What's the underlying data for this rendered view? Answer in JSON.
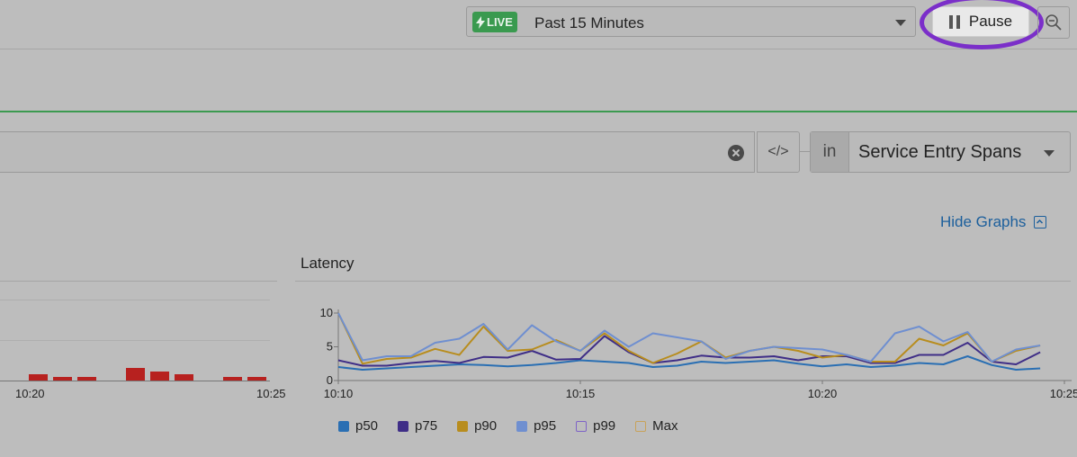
{
  "toolbar": {
    "live_badge": "LIVE",
    "time_range": "Past 15 Minutes",
    "pause_label": "Pause"
  },
  "query": {
    "code_label": "</>",
    "in_label": "in",
    "span_type": "Service Entry Spans"
  },
  "graphs": {
    "hide_label": "Hide Graphs"
  },
  "left_chart": {
    "x_ticks": [
      "10:20",
      "10:25"
    ],
    "bar_color": "#b7211f"
  },
  "chart_data": {
    "type": "line",
    "title": "Latency",
    "xlabel": "",
    "ylabel": "",
    "x_ticks": [
      "10:10",
      "10:15",
      "10:20",
      "10:25"
    ],
    "y_ticks": [
      "0",
      "5",
      "10"
    ],
    "ylim": [
      0,
      10
    ],
    "xlim_minutes": [
      0,
      15
    ],
    "legend_placement": "bottom",
    "x": [
      0,
      0.5,
      1,
      1.5,
      2,
      2.5,
      3,
      3.5,
      4,
      4.5,
      5,
      5.5,
      6,
      6.5,
      7,
      7.5,
      8,
      8.5,
      9,
      9.5,
      10,
      10.5,
      11,
      11.5,
      12,
      12.5,
      13,
      13.5,
      14,
      14.5
    ],
    "series": [
      {
        "name": "p50",
        "color": "#2a6fb3",
        "values": [
          2.0,
          1.6,
          1.8,
          2.0,
          2.2,
          2.4,
          2.3,
          2.1,
          2.3,
          2.6,
          3.0,
          2.8,
          2.6,
          2.0,
          2.2,
          2.8,
          2.6,
          2.8,
          3.0,
          2.5,
          2.1,
          2.4,
          2.0,
          2.2,
          2.6,
          2.4,
          3.6,
          2.3,
          1.6,
          1.8
        ]
      },
      {
        "name": "p75",
        "color": "#3f2e87",
        "values": [
          3.0,
          2.2,
          2.2,
          2.6,
          2.9,
          2.6,
          3.5,
          3.4,
          4.4,
          3.1,
          3.2,
          6.6,
          4.2,
          2.6,
          3.0,
          3.7,
          3.4,
          3.4,
          3.6,
          3.0,
          3.6,
          3.6,
          2.6,
          2.6,
          3.8,
          3.8,
          5.6,
          2.8,
          2.4,
          4.2
        ]
      },
      {
        "name": "p90",
        "color": "#b88d1e",
        "values": [
          10.0,
          2.5,
          3.2,
          3.4,
          4.7,
          3.8,
          8.0,
          4.4,
          4.6,
          6.0,
          4.4,
          7.0,
          4.4,
          2.6,
          4.0,
          5.8,
          3.4,
          4.4,
          5.0,
          4.4,
          3.4,
          3.8,
          2.8,
          2.8,
          6.2,
          5.2,
          7.0,
          2.8,
          4.4,
          5.2
        ]
      },
      {
        "name": "p95",
        "color": "#6f8fd0",
        "values": [
          10.0,
          3.0,
          3.6,
          3.6,
          5.6,
          6.2,
          8.4,
          4.6,
          8.2,
          5.8,
          4.4,
          7.4,
          5.0,
          7.0,
          6.4,
          5.8,
          3.2,
          4.4,
          5.0,
          4.8,
          4.6,
          3.8,
          2.8,
          7.0,
          8.0,
          5.8,
          7.2,
          2.8,
          4.6,
          5.2
        ]
      },
      {
        "name": "p99",
        "color": "#7e63c7",
        "hollow": true,
        "values": []
      },
      {
        "name": "Max",
        "color": "#c8a25a",
        "hollow": true,
        "values": []
      }
    ]
  }
}
